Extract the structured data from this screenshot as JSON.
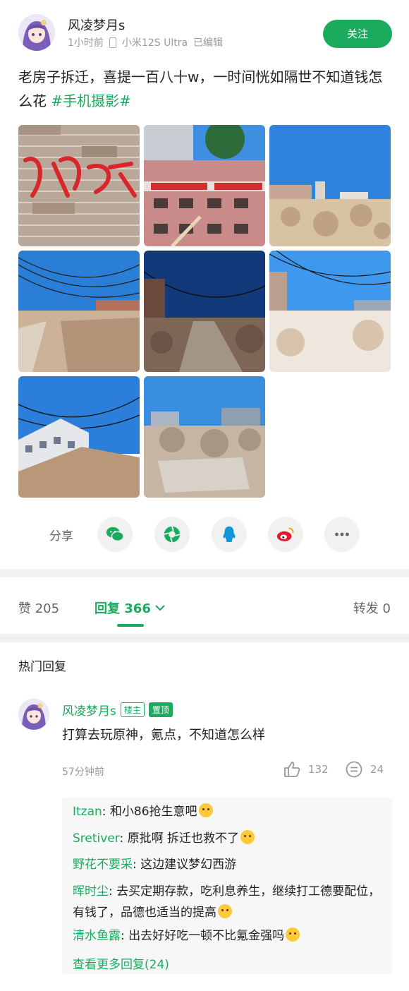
{
  "post": {
    "author": "风凌梦月s",
    "time": "1小时前",
    "device": "小米12S Ultra",
    "edited": "已编辑",
    "follow_label": "关注",
    "text": "老房子拆迁，喜提一百八十w，一时间恍如隔世不知道钱怎么花",
    "hashtag": "#手机摄影#",
    "photos": [
      "brick-wall-graffiti",
      "pink-building-banner",
      "rubble-blue-sky",
      "dirt-road-wires",
      "evening-road-rubble",
      "bright-street-rubble",
      "white-building-rubble",
      "concrete-rubble-pile"
    ]
  },
  "share": {
    "label": "分享",
    "targets": [
      "wechat-icon",
      "moments-icon",
      "qq-icon",
      "weibo-icon",
      "more-icon"
    ],
    "colors": {
      "wechat": "#1aab5e",
      "qq": "#1296db",
      "weibo": "#e6162d"
    }
  },
  "stats": {
    "likes": "赞 205",
    "replies": "回复 366",
    "shares": "转发 0"
  },
  "hot_title": "热门回复",
  "comment": {
    "author": "风凌梦月s",
    "badge_owner": "楼主",
    "badge_pinned": "置顶",
    "text": "打算去玩原神，氪点，不知道怎么样",
    "time": "57分钟前",
    "like_count": "132",
    "reply_count": "24",
    "replies": [
      {
        "name": "Itzan",
        "text": ": 和小86抢生意吧"
      },
      {
        "name": "Sretiver",
        "text": ": 原批啊 拆迁也救不了"
      },
      {
        "name": "野花不要采",
        "text": ": 这边建议梦幻西游"
      },
      {
        "name": "晖时尘",
        "text": ": 去买定期存款，吃利息养生，继续打工德要配位，有钱了，品德也适当的提高"
      },
      {
        "name": "清水鱼露",
        "text": ": 出去好好吃一顿不比氪金强吗"
      }
    ],
    "more_label": "查看更多回复(24)"
  },
  "accent": "#1aab5e"
}
